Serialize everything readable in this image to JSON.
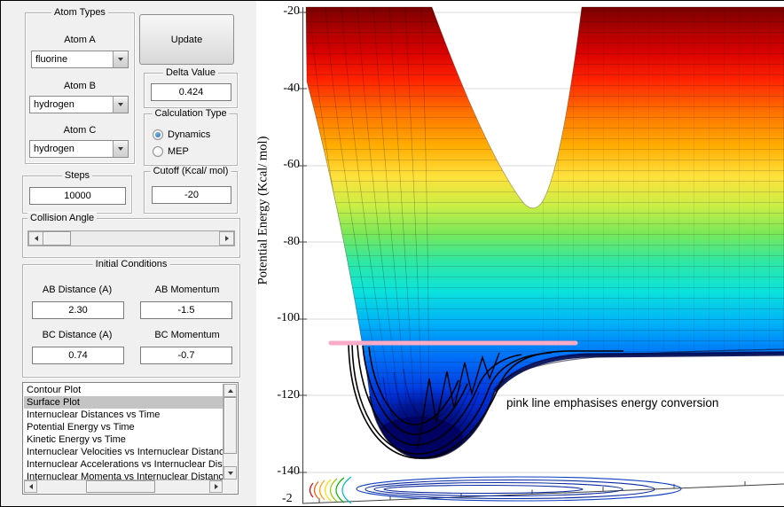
{
  "controls": {
    "atom_types": {
      "title": "Atom Types",
      "atom_a": {
        "label": "Atom A",
        "value": "fluorine"
      },
      "atom_b": {
        "label": "Atom B",
        "value": "hydrogen"
      },
      "atom_c": {
        "label": "Atom C",
        "value": "hydrogen"
      }
    },
    "update_button_label": "Update",
    "delta_value": {
      "title": "Delta Value",
      "value": "0.424"
    },
    "calculation_type": {
      "title": "Calculation Type",
      "dynamics_label": "Dynamics",
      "mep_label": "MEP",
      "selected": "Dynamics"
    },
    "steps": {
      "title": "Steps",
      "value": "10000"
    },
    "cutoff": {
      "title": "Cutoff (Kcal/ mol)",
      "value": "-20"
    },
    "collision_angle": {
      "title": "Collision Angle"
    },
    "initial_conditions": {
      "title": "Initial Conditions",
      "ab_distance": {
        "label": "AB Distance (A)",
        "value": "2.30"
      },
      "ab_momentum": {
        "label": "AB Momentum",
        "value": "-1.5"
      },
      "bc_distance": {
        "label": "BC Distance (A)",
        "value": "0.74"
      },
      "bc_momentum": {
        "label": "BC Momentum",
        "value": "-0.7"
      }
    },
    "plot_list": {
      "items": [
        "Contour Plot",
        "Surface Plot",
        "Internuclear Distances vs Time",
        "Potential Energy vs Time",
        "Kinetic Energy vs Time",
        "Internuclear Velocities vs Internuclear Distance",
        "Internuclear Accelerations vs Internuclear Distance",
        "Internuclear Momenta vs Internuclear Distance"
      ],
      "selected": "Surface Plot"
    }
  },
  "chart_data": {
    "type": "surface",
    "ylabel": "Potential Energy (Kcal/ mol)",
    "yticks": [
      "-20",
      "-40",
      "-60",
      "-80",
      "-100",
      "-120",
      "-140"
    ],
    "ylim": [
      -140,
      -20
    ],
    "xtick_label": "-2",
    "annotation": "pink line emphasises energy conversion",
    "colormap": "jet",
    "pink_line_energy": -106,
    "surface_well_minimum": -135,
    "exit_valley_floor_energy": -106,
    "grid": true
  }
}
